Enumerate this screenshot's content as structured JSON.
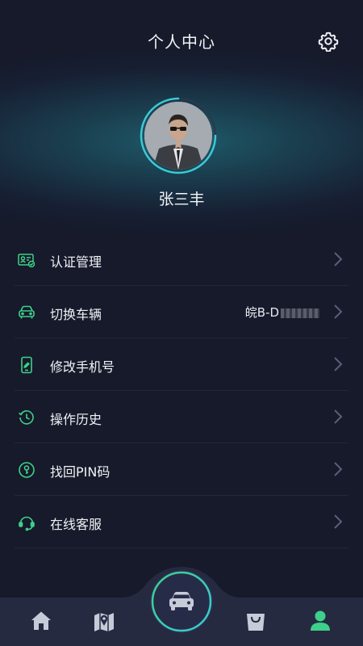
{
  "header": {
    "title": "个人中心"
  },
  "profile": {
    "name": "张三丰"
  },
  "menu": {
    "items": [
      {
        "label": "认证管理",
        "icon": "id-card-icon"
      },
      {
        "label": "切换车辆",
        "icon": "car-icon",
        "value": "皖B-D"
      },
      {
        "label": "修改手机号",
        "icon": "phone-edit-icon"
      },
      {
        "label": "操作历史",
        "icon": "history-icon"
      },
      {
        "label": "找回PIN码",
        "icon": "key-icon"
      },
      {
        "label": "在线客服",
        "icon": "headset-icon"
      }
    ]
  },
  "tabbar": {
    "items": [
      "home-icon",
      "map-icon",
      "car-icon",
      "bag-icon",
      "user-icon"
    ],
    "active": "user-icon"
  },
  "colors": {
    "accent": "#3ed08a",
    "chevron": "#5a5f7a",
    "ring": "#3cc9d6"
  }
}
